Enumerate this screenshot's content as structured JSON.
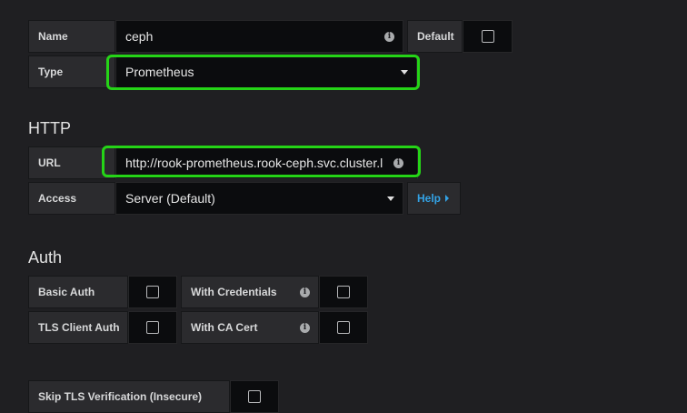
{
  "settings": {
    "name_label": "Name",
    "name_value": "ceph",
    "default_label": "Default",
    "default_checked": false,
    "type_label": "Type",
    "type_value": "Prometheus"
  },
  "http": {
    "heading": "HTTP",
    "url_label": "URL",
    "url_value": "http://rook-prometheus.rook-ceph.svc.cluster.l",
    "access_label": "Access",
    "access_value": "Server (Default)",
    "help_label": "Help"
  },
  "auth": {
    "heading": "Auth",
    "basic_auth_label": "Basic Auth",
    "with_credentials_label": "With Credentials",
    "tls_client_auth_label": "TLS Client Auth",
    "with_ca_cert_label": "With CA Cert",
    "skip_tls_label": "Skip TLS Verification (Insecure)"
  },
  "icons": {
    "info": "info-icon",
    "caret": "chevron-down-icon",
    "help_caret": "chevron-right-icon"
  },
  "colors": {
    "highlight": "#25d417",
    "link": "#33a2e5",
    "background": "#1f1f22"
  }
}
